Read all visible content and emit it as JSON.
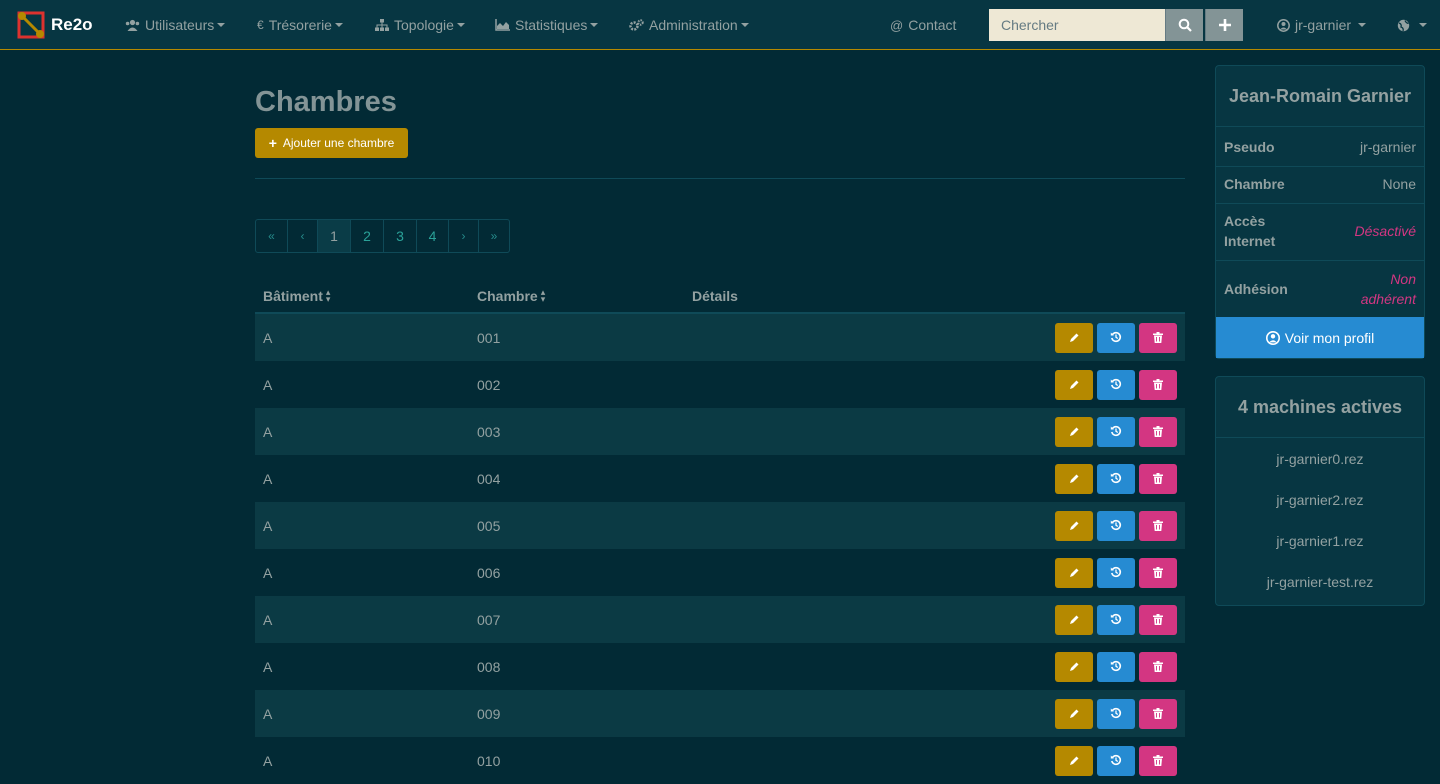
{
  "nav": {
    "brand": "Re2o",
    "menus": [
      {
        "label": "Utilisateurs",
        "icon": "users-icon"
      },
      {
        "label": "Trésorerie",
        "icon": "euro-icon"
      },
      {
        "label": "Topologie",
        "icon": "sitemap-icon"
      },
      {
        "label": "Statistiques",
        "icon": "area-chart-icon"
      },
      {
        "label": "Administration",
        "icon": "cogs-icon"
      }
    ],
    "contact": "Contact",
    "search_placeholder": "Chercher",
    "user": "jr-garnier"
  },
  "main": {
    "title": "Chambres",
    "add_button": "Ajouter une chambre",
    "pagination": [
      "«",
      "‹",
      "1",
      "2",
      "3",
      "4",
      "›",
      "»"
    ],
    "active_page": "1",
    "columns": [
      "Bâtiment",
      "Chambre",
      "Détails"
    ],
    "rows": [
      {
        "building": "A",
        "room": "001",
        "details": ""
      },
      {
        "building": "A",
        "room": "002",
        "details": ""
      },
      {
        "building": "A",
        "room": "003",
        "details": ""
      },
      {
        "building": "A",
        "room": "004",
        "details": ""
      },
      {
        "building": "A",
        "room": "005",
        "details": ""
      },
      {
        "building": "A",
        "room": "006",
        "details": ""
      },
      {
        "building": "A",
        "room": "007",
        "details": ""
      },
      {
        "building": "A",
        "room": "008",
        "details": ""
      },
      {
        "building": "A",
        "room": "009",
        "details": ""
      },
      {
        "building": "A",
        "room": "010",
        "details": ""
      }
    ]
  },
  "profile": {
    "name": "Jean-Romain Garnier",
    "fields": [
      {
        "label": "Pseudo",
        "value": "jr-garnier",
        "status": "normal"
      },
      {
        "label": "Chambre",
        "value": "None",
        "status": "normal"
      },
      {
        "label": "Accès Internet",
        "value": "Désactivé",
        "status": "warning"
      },
      {
        "label": "Adhésion",
        "value": "Non adhérent",
        "status": "warning"
      }
    ],
    "profile_button": "Voir mon profil"
  },
  "machines": {
    "title": "4 machines actives",
    "items": [
      "jr-garnier0.rez",
      "jr-garnier2.rez",
      "jr-garnier1.rez",
      "jr-garnier-test.rez"
    ]
  },
  "colors": {
    "background": "#022a35",
    "navbar": "#073642",
    "accent_yellow": "#b58900",
    "accent_blue": "#268bd2",
    "accent_magenta": "#d33682",
    "link_cyan": "#2aa198"
  }
}
